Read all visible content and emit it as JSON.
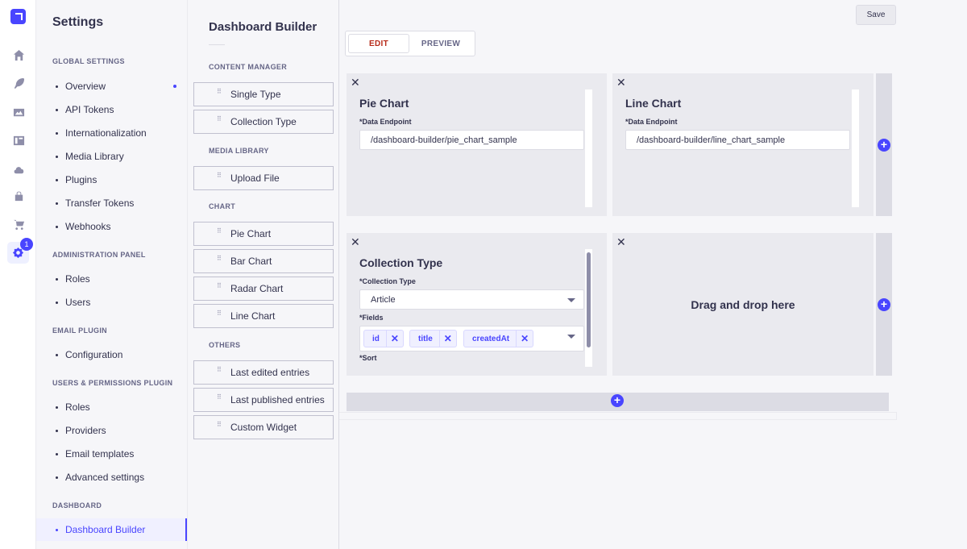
{
  "rail": {
    "icons": [
      "logo-icon",
      "home-icon",
      "feather-icon",
      "media-icon",
      "layout-icon",
      "cloud-icon",
      "bag-icon",
      "cart-icon",
      "settings-icon"
    ],
    "badge": "1",
    "accent": "#4945ff"
  },
  "settings": {
    "title": "Settings",
    "sections": [
      {
        "label": "GLOBAL SETTINGS",
        "items": [
          "Overview",
          "API Tokens",
          "Internationalization",
          "Media Library",
          "Plugins",
          "Transfer Tokens",
          "Webhooks"
        ]
      },
      {
        "label": "ADMINISTRATION PANEL",
        "items": [
          "Roles",
          "Users"
        ]
      },
      {
        "label": "EMAIL PLUGIN",
        "items": [
          "Configuration"
        ]
      },
      {
        "label": "USERS & PERMISSIONS PLUGIN",
        "items": [
          "Roles",
          "Providers",
          "Email templates",
          "Advanced settings"
        ]
      },
      {
        "label": "DASHBOARD",
        "items": [
          "Dashboard Builder"
        ]
      }
    ],
    "active": "Dashboard Builder"
  },
  "palette": {
    "title": "Dashboard Builder",
    "sections": [
      {
        "label": "CONTENT MANAGER",
        "items": [
          "Single Type",
          "Collection Type"
        ]
      },
      {
        "label": "MEDIA LIBRARY",
        "items": [
          "Upload File"
        ]
      },
      {
        "label": "CHART",
        "items": [
          "Pie Chart",
          "Bar Chart",
          "Radar Chart",
          "Line Chart"
        ]
      },
      {
        "label": "OTHERS",
        "items": [
          "Last edited entries",
          "Last published entries",
          "Custom Widget"
        ]
      }
    ]
  },
  "main": {
    "save_label": "Save",
    "tabs": {
      "edit": "EDIT",
      "preview": "PREVIEW"
    },
    "widgets": {
      "pie": {
        "title": "Pie Chart",
        "label": "*Data Endpoint",
        "value": "/dashboard-builder/pie_chart_sample"
      },
      "line": {
        "title": "Line Chart",
        "label": "*Data Endpoint",
        "value": "/dashboard-builder/line_chart_sample"
      },
      "collection": {
        "title": "Collection Type",
        "type_label": "*Collection Type",
        "type_value": "Article",
        "fields_label": "*Fields",
        "fields": [
          "id",
          "title",
          "createdAt"
        ],
        "sort_label": "*Sort"
      },
      "dropzone": {
        "text": "Drag and drop here"
      }
    },
    "close_glyph": "✕",
    "remove_glyph": "✕",
    "plus_glyph": "+"
  }
}
